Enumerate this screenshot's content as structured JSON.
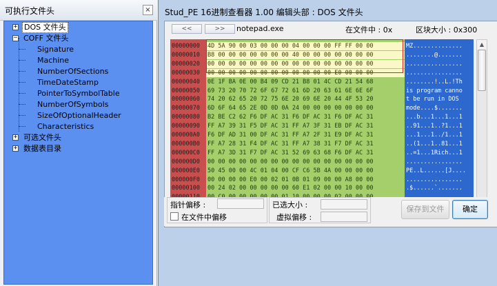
{
  "left_panel": {
    "title": "可执行文件头",
    "close": "×",
    "tree": {
      "dos_header": "DOS 文件头",
      "coff_header": "COFF 文件头",
      "coff_children": [
        "Signature",
        "Machine",
        "NumberOfSections",
        "TimeDateStamp",
        "PointerToSymbolTable",
        "NumberOfSymbols",
        "SizeOfOptionalHeader",
        "Characteristics"
      ],
      "optional_header": "可选文件头",
      "data_directory": "数据表目录",
      "expand_plus": "+",
      "expand_minus": "−"
    }
  },
  "main": {
    "title": "Stud_PE 16进制查看器 1.00 编辑头部 : DOS 文件头",
    "prev_button": "<<",
    "next_button": ">>",
    "file_name": "notepad.exe",
    "file_offset": "在文件中 : 0x",
    "block_size": "区块大小 : 0x300",
    "hex": {
      "addresses": [
        "00000000",
        "00000010",
        "00000020",
        "00000030",
        "00000040",
        "00000050",
        "00000060",
        "00000070",
        "00000080",
        "00000090",
        "000000A0",
        "000000B0",
        "000000C0",
        "000000D0",
        "000000E0",
        "000000F0",
        "00000100",
        "00000110"
      ],
      "rows": [
        "4D 5A 90 00 03 00 00 00 04 00 00 00 FF FF 00 00",
        "B8 00 00 00 00 00 00 00 40 00 00 00 00 00 00 00",
        "00 00 00 00 00 00 00 00 00 00 00 00 00 00 00 00",
        "00 00 00 00 00 00 00 00 00 00 00 00 E0 00 00 00",
        "0E 1F BA 0E 00 B4 09 CD 21 B8 01 4C CD 21 54 68",
        "69 73 20 70 72 6F 67 72 61 6D 20 63 61 6E 6E 6F",
        "74 20 62 65 20 72 75 6E 20 69 6E 20 44 4F 53 20",
        "6D 6F 64 65 2E 0D 0D 0A 24 00 00 00 00 00 00 00",
        "B2 BE C2 62 F6 DF AC 31 F6 DF AC 31 F6 DF AC 31",
        "FF A7 39 31 F5 DF AC 31 FF A7 3F 31 EB DF AC 31",
        "F6 DF AD 31 00 DF AC 31 FF A7 2F 31 E9 DF AC 31",
        "FF A7 28 31 F4 DF AC 31 FF A7 38 31 F7 DF AC 31",
        "FF A7 3D 31 F7 DF AC 31 52 69 63 68 F6 DF AC 31",
        "00 00 00 00 00 00 00 00 00 00 00 00 00 00 00 00",
        "50 45 00 00 4C 01 04 00 CF C6 5B 4A 00 00 00 00",
        "00 00 00 00 E0 00 02 01 0B 01 09 00 00 A8 00 00",
        "00 24 02 00 00 00 00 00 60 E1 02 00 00 10 00 00",
        "00 C0 00 00 00 00 00 01 10 00 00 00 02 00 00 00"
      ],
      "ascii": [
        "MZ..............",
        "........@.......",
        "................",
        "................",
        "........!..L.!Th",
        "is program canno",
        "t be run in DOS ",
        "mode....$.......",
        "...b...1...1...1",
        "..91...1..?1...1",
        "...1...1../1...1",
        "..(1...1..81...1",
        "..=1...1Rich...1",
        "................",
        "PE..L......[J....",
        "................",
        ".$......`.......",
        "................"
      ]
    },
    "scroll_up": "▲",
    "scroll_down": "▼",
    "pointer_offset_label": "指针偏移 :",
    "in_file_offset_label": "在文件中偏移",
    "selected_size_label": "已选大小 :",
    "virtual_offset_label": "虚拟偏移 :",
    "save_button": "保存到文件",
    "ok_button": "确定"
  }
}
